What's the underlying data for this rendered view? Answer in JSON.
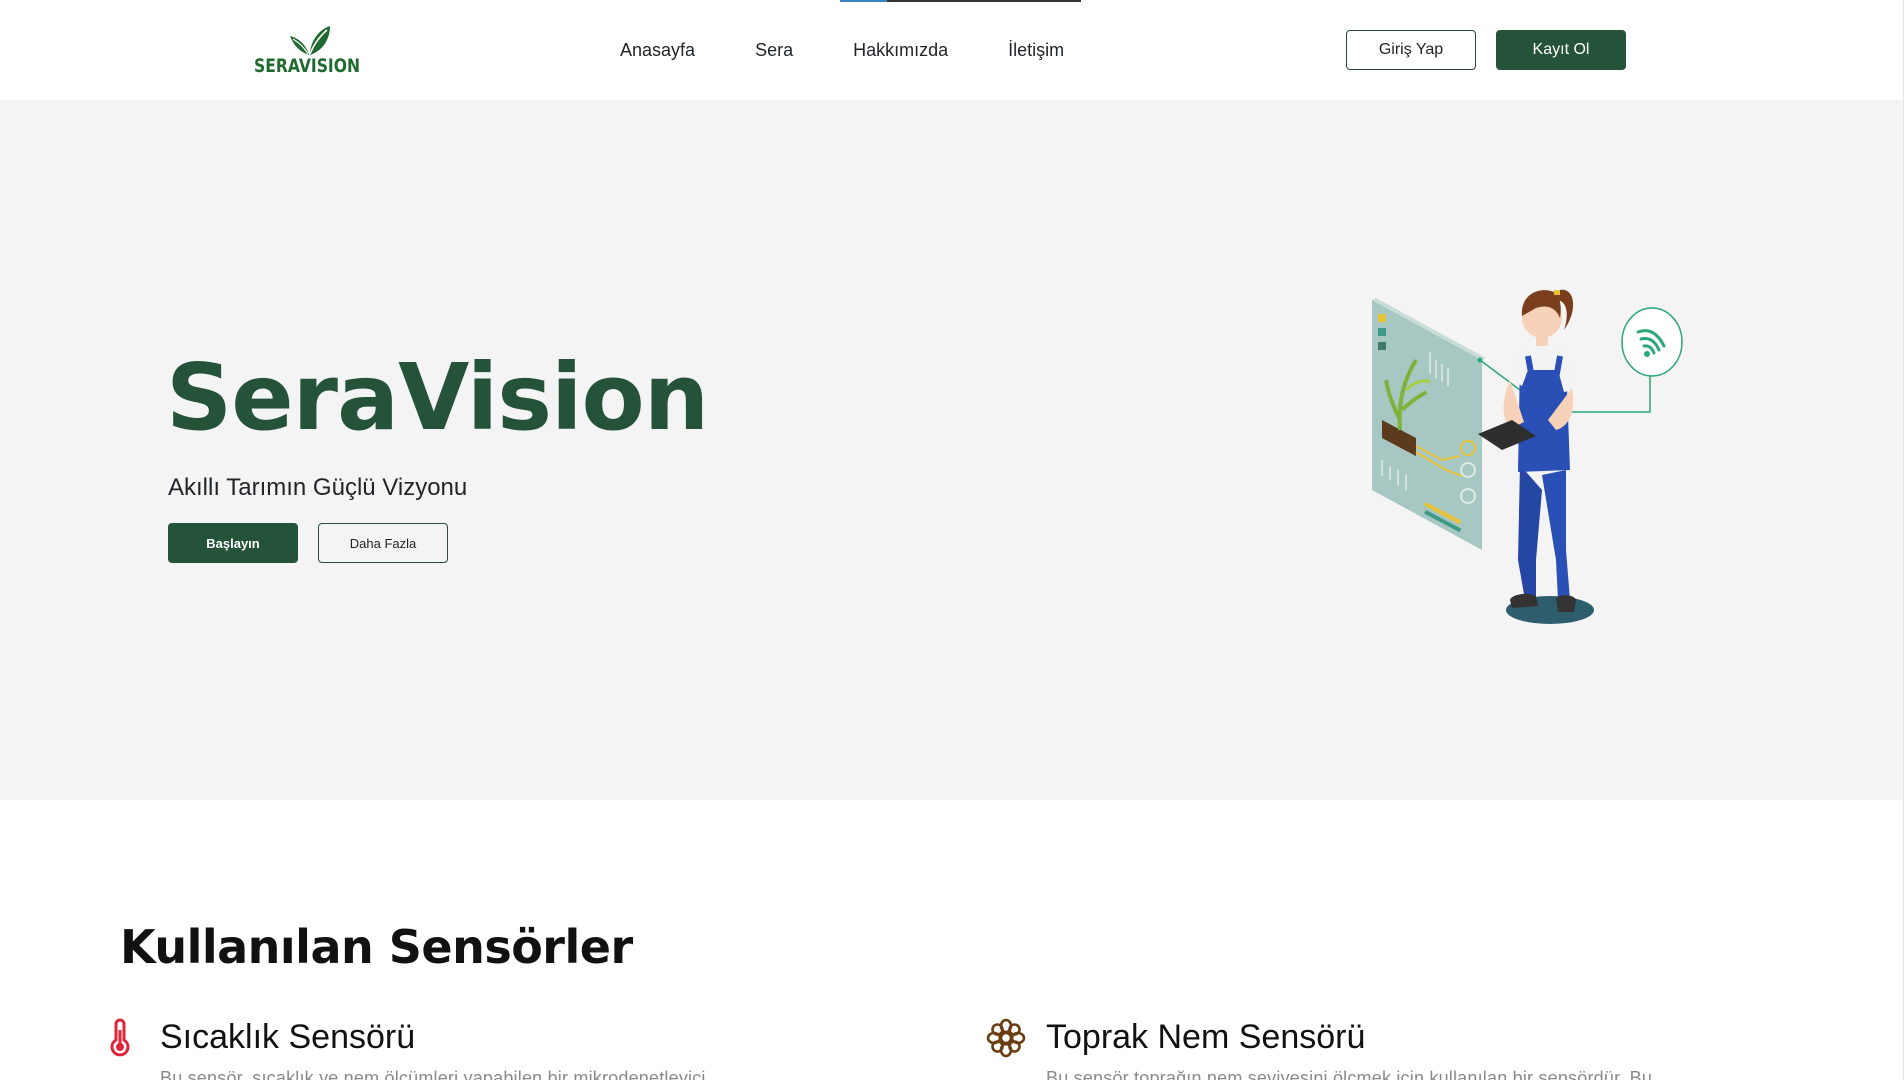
{
  "brand": {
    "logo_text": "SERAVISION",
    "primary_color": "#25533a",
    "logo_color": "#1f6b2f"
  },
  "nav": {
    "items": [
      {
        "label": "Anasayfa"
      },
      {
        "label": "Sera"
      },
      {
        "label": "Hakkımızda"
      },
      {
        "label": "İletişim"
      }
    ]
  },
  "auth": {
    "login_label": "Giriş Yap",
    "register_label": "Kayıt Ol"
  },
  "hero": {
    "title": "SeraVision",
    "subtitle": "Akıllı Tarımın Güçlü Vizyonu",
    "primary_button": "Başlayın",
    "secondary_button": "Daha Fazla",
    "illustration": "woman-with-tablet-and-smart-greenhouse-panel"
  },
  "sensors": {
    "title": "Kullanılan Sensörler",
    "items": [
      {
        "name": "Sıcaklık Sensörü",
        "icon": "thermometer-icon",
        "icon_color": "#e0263b",
        "description": "Bu sensör, sıcaklık ve nem ölçümleri yapabilen bir mikrodenetleyici"
      },
      {
        "name": "Toprak Nem Sensörü",
        "icon": "flower-icon",
        "icon_color": "#6b3d12",
        "description": "Bu sensör toprağın nem seviyesini ölçmek için kullanılan bir sensördür. Bu"
      }
    ]
  }
}
